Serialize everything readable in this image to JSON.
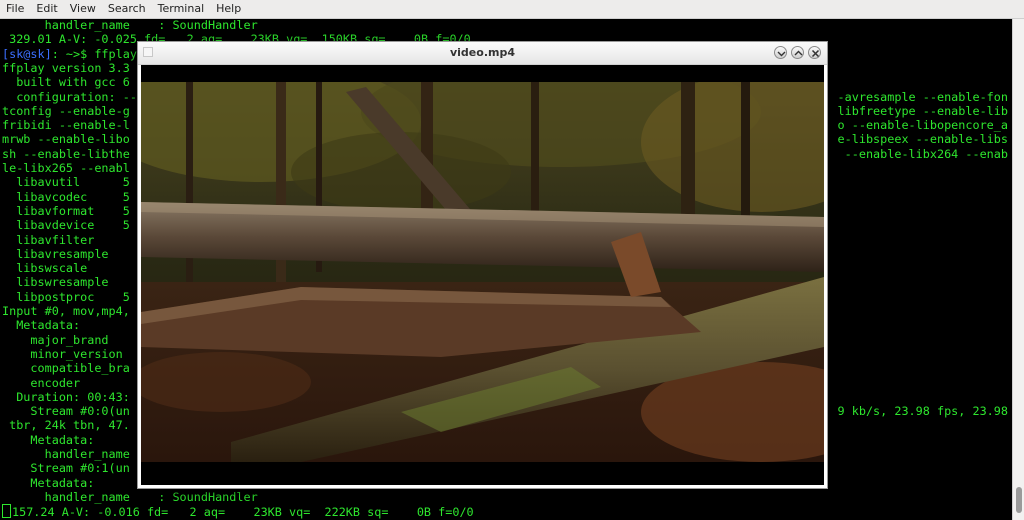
{
  "menu": [
    "File",
    "Edit",
    "View",
    "Search",
    "Terminal",
    "Help"
  ],
  "terminal": {
    "prompt_user": "[sk@sk]",
    "lines": [
      "      handler_name    : SoundHandler",
      " 329.01 A-V: -0.025 fd=   2 aq=    23KB vq=  150KB sq=    0B f=0/0",
      "[sk@sk]: ~>$ ffplay",
      "ffplay version 3.3",
      "  built with gcc 6",
      "  configuration: --",
      "tconfig --enable-g",
      "fribidi --enable-l",
      "mrwb --enable-libo",
      "sh --enable-libthe",
      "le-libx265 --enabl",
      "  libavutil      5",
      "  libavcodec     5",
      "  libavformat    5",
      "  libavdevice    5",
      "  libavfilter",
      "  libavresample",
      "  libswscale",
      "  libswresample",
      "  libpostproc    5",
      "Input #0, mov,mp4,",
      "  Metadata:",
      "    major_brand",
      "    minor_version",
      "    compatible_bra",
      "    encoder",
      "  Duration: 00:43:",
      "    Stream #0:0(un",
      " tbr, 24k tbn, 47.",
      "    Metadata:",
      "      handler_name",
      "    Stream #0:1(un",
      "    Metadata:",
      "      handler_name    : SoundHandler",
      "157.24 A-V: -0.016 fd=   2 aq=    23KB vq=  222KB sq=    0B f=0/0"
    ],
    "right_lines": [
      {
        "row": 5,
        "text": "-avresample --enable-fon"
      },
      {
        "row": 6,
        "text": "libfreetype --enable-lib"
      },
      {
        "row": 7,
        "text": "o --enable-libopencore_a"
      },
      {
        "row": 8,
        "text": "e-libspeex --enable-libs"
      },
      {
        "row": 9,
        "text": "--enable-libx264 --enab"
      },
      {
        "row": 27,
        "text": "9 kb/s, 23.98 fps, 23.98"
      }
    ]
  },
  "video_window": {
    "title": "video.mp4",
    "controls": [
      "minimize-icon",
      "maximize-icon",
      "close-icon"
    ]
  },
  "colors": {
    "terminal_text": "#2ee62e",
    "prompt_user": "#3b6fff",
    "terminal_bg": "#000000"
  }
}
